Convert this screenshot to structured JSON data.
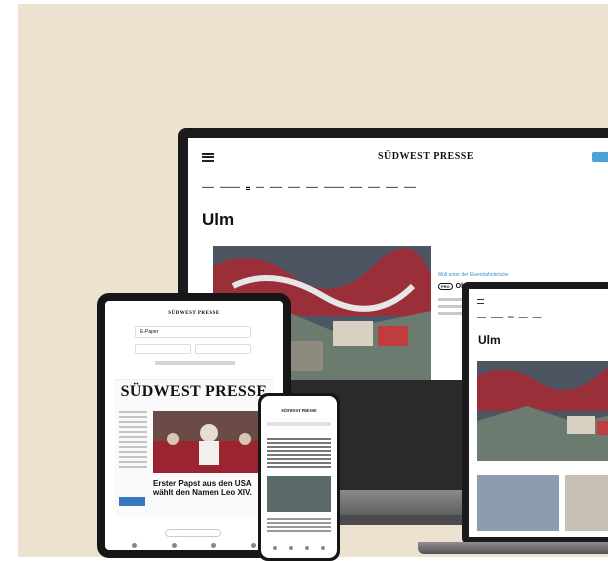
{
  "scene": {
    "background_color": "#ede1cf",
    "devices": [
      "monitor",
      "laptop",
      "tablet",
      "phone"
    ],
    "brand_name": "SÜDWEST PRESSE"
  },
  "monitor": {
    "masthead": "SÜDWEST PRESSE",
    "city_title": "Ulm",
    "kicker": "Müll unter der Eisenbahnbrücke",
    "headline": "Ob",
    "pro_badge": "PRO",
    "icon": "apple-logo-icon",
    "accent_color": "#4aa3d6"
  },
  "laptop": {
    "city_title": "Ulm",
    "active_nav": "Ulm"
  },
  "tablet": {
    "app_masthead": "SÜDWEST PRESSE",
    "field_value": "E-Paper",
    "paper_title": "SÜDWEST PRESSE",
    "paper_headline": "Erster Papst aus den USA wählt den Namen Leo XIV."
  },
  "phone": {
    "masthead": "SÜDWEST PRESSE"
  }
}
